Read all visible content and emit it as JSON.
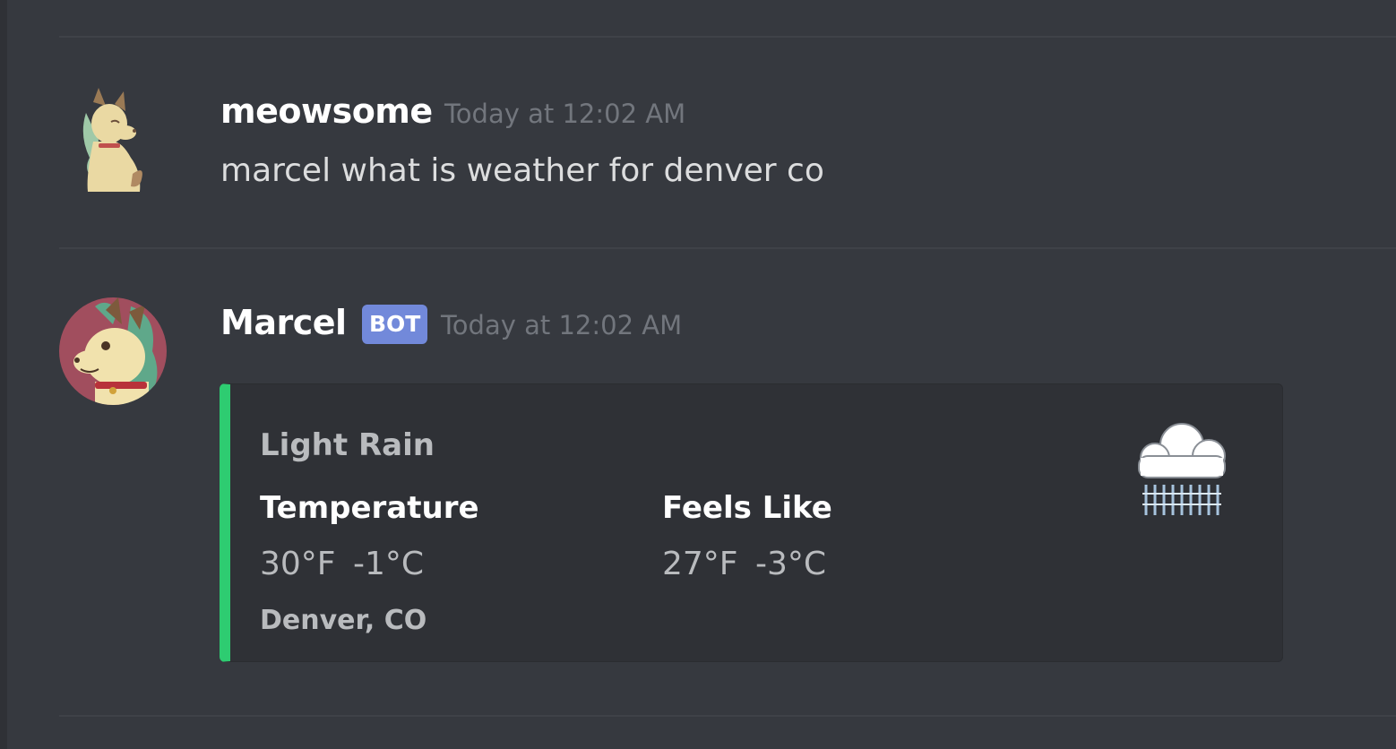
{
  "messages": [
    {
      "username": "meowsome",
      "timestamp": "Today at 12:02 AM",
      "text": "marcel what is weather for denver co",
      "avatar_icon": "cat-character-avatar-icon"
    },
    {
      "username": "Marcel",
      "bot_tag": "BOT",
      "timestamp": "Today at 12:02 AM",
      "avatar_icon": "dog-character-avatar-icon",
      "embed": {
        "accent_color": "#2ecc71",
        "title": "Light Rain",
        "fields": [
          {
            "name": "Temperature",
            "value": "30°F   -1°C"
          },
          {
            "name": "Feels Like",
            "value": "27°F   -3°C"
          }
        ],
        "footer": "Denver, CO",
        "thumbnail_icon": "rain-cloud-icon"
      }
    }
  ],
  "colors": {
    "background": "#36393f",
    "embed_background": "#2f3136",
    "bot_tag": "#7289da",
    "timestamp": "#72767d"
  }
}
